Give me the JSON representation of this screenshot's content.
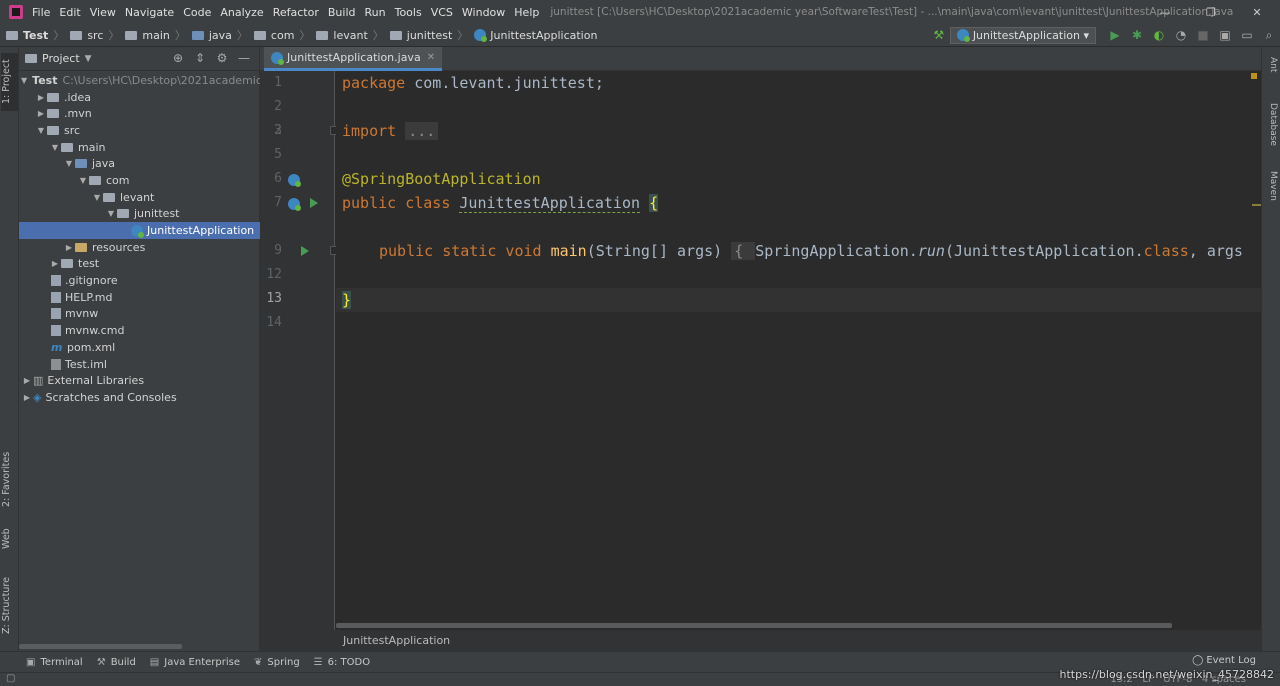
{
  "menubar": {
    "items": [
      "File",
      "Edit",
      "View",
      "Navigate",
      "Code",
      "Analyze",
      "Refactor",
      "Build",
      "Run",
      "Tools",
      "VCS",
      "Window",
      "Help"
    ],
    "window_title": "junittest [C:\\Users\\HC\\Desktop\\2021academic year\\SoftwareTest\\Test] - ...\\main\\java\\com\\levant\\junittest\\JunittestApplication.java"
  },
  "navbar": {
    "crumbs": [
      "Test",
      "src",
      "main",
      "java",
      "com",
      "levant",
      "junittest",
      "JunittestApplication"
    ],
    "run_config": "JunittestApplication"
  },
  "left_strip": {
    "project": "1: Project",
    "favorites": "2: Favorites",
    "web": "Web",
    "structure": "Z: Structure"
  },
  "right_strip": {
    "ant": "Ant",
    "database": "Database",
    "maven": "Maven"
  },
  "project": {
    "title": "Project",
    "root_name": "Test",
    "root_path": "C:\\Users\\HC\\Desktop\\2021academic y",
    "nodes": [
      ".idea",
      ".mvn",
      "src",
      "main",
      "java",
      "com",
      "levant",
      "junittest",
      "JunittestApplication",
      "resources",
      "test",
      ".gitignore",
      "HELP.md",
      "mvnw",
      "mvnw.cmd",
      "pom.xml",
      "Test.iml",
      "External Libraries",
      "Scratches and Consoles"
    ]
  },
  "editor": {
    "tab_label": "JunittestApplication.java",
    "line_numbers": [
      "1",
      "2",
      "3",
      "5",
      "6",
      "7",
      "9",
      "12",
      "13",
      "14"
    ],
    "code": {
      "l1_kw": "package",
      "l1_rest": " com.levant.junittest;",
      "l3_kw": "import",
      "l3_fold": "...",
      "l6": "@SpringBootApplication",
      "l7_kw": "public class ",
      "l7_name": "JunittestApplication",
      "l7_brace": "{",
      "l9_kw": "public static void ",
      "l9_fn": "main",
      "l9_args": "(String[] args) ",
      "l9_fold": "{ ",
      "l9_call": "SpringApplication.",
      "l9_run": "run",
      "l9_tail": "(JunittestApplication.",
      "l9_class": "class",
      "l9_end": ", args",
      "l13": "}"
    },
    "breadcrumb": "JunittestApplication"
  },
  "toolwindows": {
    "items": [
      "Terminal",
      "Build",
      "Java Enterprise",
      "Spring",
      "6: TODO"
    ],
    "event_log": "Event Log"
  },
  "statusbar": {
    "position": "13:2",
    "line_sep": "LF",
    "encoding": "UTF-8",
    "indent": "4 spaces",
    "watermark": "https://blog.csdn.net/weixin_45728842"
  }
}
